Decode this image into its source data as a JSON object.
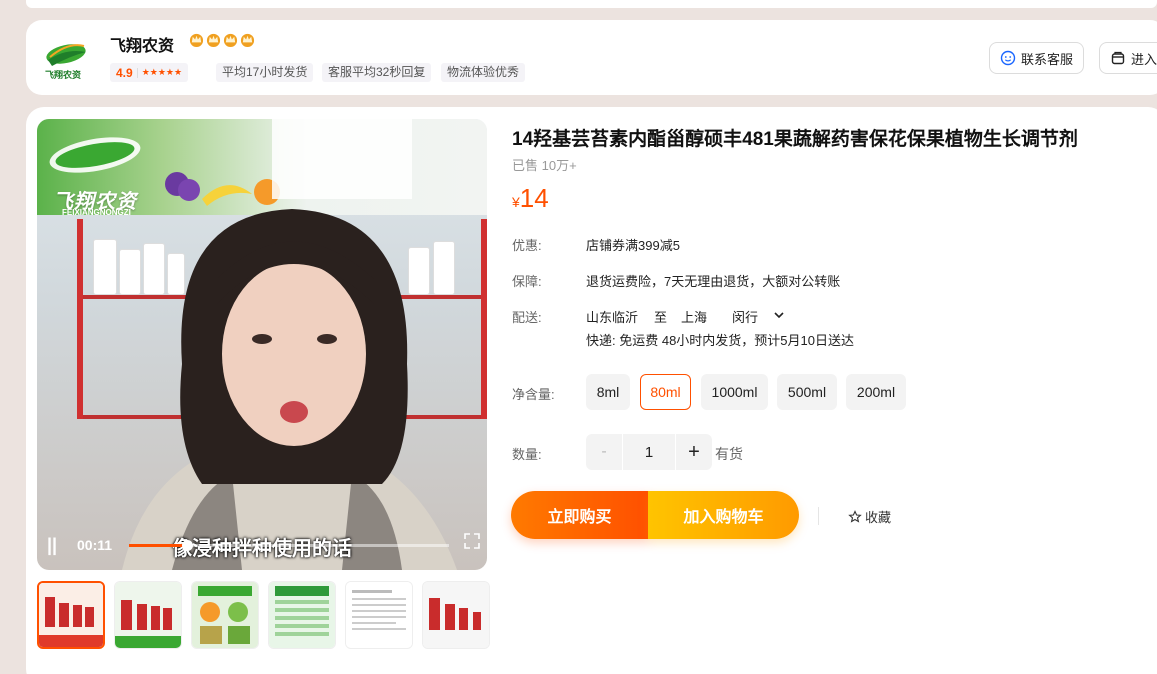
{
  "shop": {
    "name": "飞翔农资",
    "crown_count": 4,
    "rating": "4.9",
    "stars": "★★★★★",
    "tags": [
      "平均17小时发货",
      "客服平均32秒回复",
      "物流体验优秀"
    ],
    "contact_label": "联系客服",
    "enter_label": "进入"
  },
  "video": {
    "banner_brand": "飞翔农资",
    "banner_sub": "FEIXIANGNONGZI",
    "subtitle": "像浸种拌种使用的话",
    "time": "00:11",
    "progress": 0.18,
    "pause_icon": "||"
  },
  "thumbnails": [
    "thumb-1",
    "thumb-2",
    "thumb-3",
    "thumb-4",
    "thumb-5",
    "thumb-6"
  ],
  "product": {
    "title": "14羟基芸苔素内酯甾醇硕丰481果蔬解药害保花保果植物生长调节剂",
    "sold": "已售 10万+",
    "currency": "¥",
    "price": "14",
    "promo_label": "优惠:",
    "promo_value": "店铺券满399减5",
    "guarantee_label": "保障:",
    "guarantee_value": "退货运费险，7天无理由退货，大额对公转账",
    "delivery_label": "配送:",
    "delivery_from": "山东临沂",
    "delivery_to_word": "至",
    "delivery_city": "上海",
    "delivery_district": "闵行",
    "delivery_detail": "快递: 免运费  48小时内发货，预计5月10日送达",
    "spec_label": "净含量:",
    "specs": [
      "8ml",
      "80ml",
      "1000ml",
      "500ml",
      "200ml"
    ],
    "selected_spec": "80ml",
    "qty_label": "数量:",
    "qty_minus": "-",
    "qty_value": "1",
    "qty_plus": "+",
    "stock": "有货",
    "buy_label": "立即购买",
    "cart_label": "加入购物车",
    "fav_label": "收藏"
  },
  "colors": {
    "accent": "#ff5000",
    "cart": "#ffa200",
    "background": "#ece3df"
  }
}
